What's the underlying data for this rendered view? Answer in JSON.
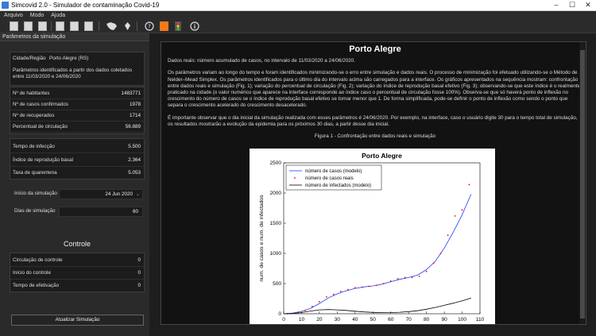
{
  "window": {
    "title": "Simcovid 2.0 - Simulador de contaminação Covid-19"
  },
  "menu": [
    "Arquivo",
    "Modo",
    "Ajuda"
  ],
  "toolbar": {
    "icons": [
      "new-doc-icon",
      "doc-icon",
      "doc-icon",
      "doc-icon",
      "doc-icon",
      "doc-icon",
      "brazil-map-icon",
      "pin-icon",
      "help-icon",
      "orange-book-icon",
      "traffic-light-icon",
      "info-icon"
    ]
  },
  "panel": {
    "header": "Parâmetros da simulação"
  },
  "region": {
    "label": "Cidade/Região",
    "value": "Porto Alegre (RS)",
    "note": "Parâmetros identificados a partir dos dados coletados entre 11/03/2020 e 24/06/2020"
  },
  "stats": [
    {
      "label": "Nº de habitantes",
      "value": "1483771"
    },
    {
      "label": "Nº de casos confirmados",
      "value": "1978"
    },
    {
      "label": "Nº de recuperados",
      "value": "1714"
    },
    {
      "label": "Percentual de circulação",
      "value": "56.889"
    }
  ],
  "params": [
    {
      "label": "Tempo de infecção",
      "value": "5.500"
    },
    {
      "label": "Índice de reprodução basal",
      "value": "2.364"
    },
    {
      "label": "Taxa de quarentena",
      "value": "5.053"
    }
  ],
  "sim": {
    "start_label": "Início da simulação",
    "start_value": "24 Jun 2020",
    "days_label": "Dias de simulação",
    "days_value": "60"
  },
  "controle": {
    "heading": "Controle",
    "rows": [
      {
        "label": "Circulação de controle",
        "value": "0"
      },
      {
        "label": "Início do controle",
        "value": "0"
      },
      {
        "label": "Tempo de efetivação",
        "value": "0"
      }
    ]
  },
  "update_button": "Atualizar Simulação",
  "main": {
    "title": "Porto Alegre",
    "p1": "Dados reais: número acumulado de casos, no intervalo de 11/03/2020 a 24/06/2020.",
    "p2": "Os parâmetros variam ao longo do tempo e foram identificados minimizando-se o erro entre simulação e dados reais. O processo de minimização foi efetuado utilizando-se o Método de Nelder–Mead Simplex. Os parâmetros identificados para o último dia do intervalo acima são carregados para a interface. Os gráficos apresentados na sequência mostram: confrontação entre dados reais e simulação (Fig. 1); variação do percentual de circulação (Fig. 2); variação do índice de reprodução basal efetivo (Fig. 3); observando-se que este índice é o realmente praticado na cidade (o valor numérico que aparece na interface corresponde ao índice caso o percentual de circulação fosse 100%). Observa-se que só haverá ponto de inflexão no crescimento do número de casos se o índice de reprodução basal efetivo se tornar menor que 1. De forma simplificada, pode-se definir o ponto de inflexão como sendo o ponto que separa o crescimento acelerado do crescimento desacelerado.",
    "p3": "É importante observar que o dia inicial da simulação realizada com esses parâmetros é 24/06/2020. Por exemplo, na interface, caso o usuário digite 30 para o tempo total de simulação, os resultados mostrarão a evolução da epidemia para os próximos 30 dias, a partir desse dia inicial.",
    "figcap": "Figura 1 - Confrontação entre dados reais e simulação"
  },
  "chart_data": {
    "type": "line",
    "title": "Porto Alegre",
    "xlabel": "",
    "ylabel": "num. de casos e num. de infectados",
    "xlim": [
      0,
      110
    ],
    "ylim": [
      0,
      2500
    ],
    "xticks": [
      0,
      10,
      20,
      30,
      40,
      50,
      60,
      70,
      80,
      90,
      100,
      110
    ],
    "yticks": [
      0,
      500,
      1000,
      1500,
      2000,
      2500
    ],
    "legend": "top-left",
    "series": [
      {
        "name": "número de casos (modelo)",
        "color": "#1f3cff",
        "style": "line",
        "x": [
          0,
          5,
          10,
          15,
          20,
          25,
          30,
          35,
          40,
          45,
          50,
          55,
          60,
          65,
          70,
          75,
          80,
          85,
          90,
          95,
          100,
          105
        ],
        "y": [
          0,
          10,
          40,
          90,
          170,
          260,
          330,
          380,
          420,
          445,
          460,
          490,
          530,
          570,
          600,
          640,
          730,
          870,
          1090,
          1350,
          1640,
          1980
        ]
      },
      {
        "name": "número de casos reais",
        "color": "#ff0000",
        "style": "points",
        "x": [
          2,
          8,
          12,
          16,
          20,
          24,
          28,
          32,
          36,
          40,
          44,
          48,
          52,
          56,
          60,
          64,
          68,
          72,
          76,
          80,
          84,
          88,
          92,
          96,
          100,
          104
        ],
        "y": [
          2,
          20,
          55,
          120,
          200,
          280,
          320,
          370,
          400,
          430,
          440,
          455,
          470,
          500,
          540,
          580,
          600,
          600,
          620,
          700,
          840,
          1000,
          1300,
          1620,
          1720,
          2140
        ]
      },
      {
        "name": "número de infectados (modelo)",
        "color": "#000000",
        "style": "line",
        "x": [
          0,
          5,
          10,
          15,
          20,
          25,
          30,
          35,
          40,
          45,
          50,
          55,
          60,
          65,
          70,
          75,
          80,
          85,
          90,
          95,
          100,
          105
        ],
        "y": [
          0,
          5,
          20,
          45,
          65,
          70,
          65,
          55,
          42,
          30,
          22,
          18,
          20,
          25,
          35,
          50,
          75,
          105,
          140,
          175,
          215,
          260
        ]
      }
    ]
  }
}
